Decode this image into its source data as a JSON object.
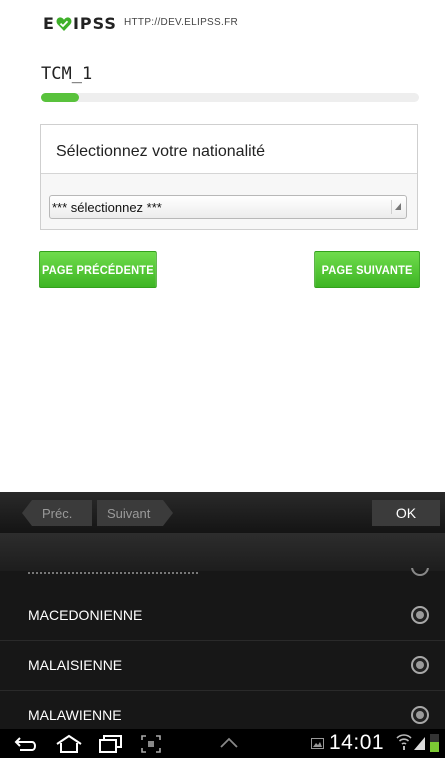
{
  "header": {
    "logo_left": "E",
    "logo_right": "IPSS",
    "url": "HTTP://DEV.ELIPSS.FR"
  },
  "survey": {
    "title": "TCM_1",
    "progress_fraction": 0.1
  },
  "question": {
    "label": "Sélectionnez votre nationalité",
    "select_value": "*** sélectionnez ***"
  },
  "buttons": {
    "prev_label": "PAGE PRÉCÉDENTE",
    "next_label": "PAGE SUIVANTE"
  },
  "keyboard_nav": {
    "prev_label": "Préc.",
    "next_label": "Suivant",
    "ok_label": "OK"
  },
  "picker": {
    "options": [
      {
        "label": "MACEDONIENNE"
      },
      {
        "label": "MALAISIENNE"
      },
      {
        "label": "MALAWIENNE"
      }
    ]
  },
  "status_bar": {
    "time": "14:01"
  },
  "colors": {
    "accent_green": "#59c23c",
    "button_green": "#3eb524",
    "logo_heart": "#3fb02a"
  }
}
